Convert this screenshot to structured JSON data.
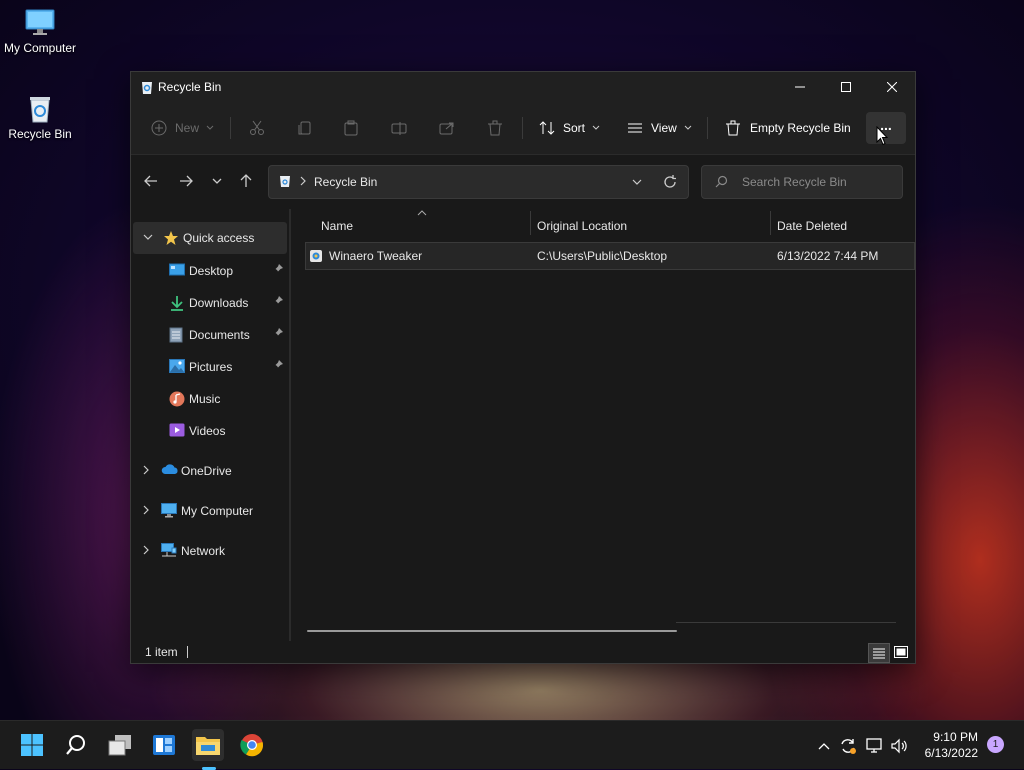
{
  "desktop": {
    "icons": [
      {
        "label": "My Computer",
        "icon": "monitor-icon"
      },
      {
        "label": "Recycle Bin",
        "icon": "recycle-bin-icon"
      }
    ]
  },
  "window": {
    "title": "Recycle Bin",
    "controls": {
      "minimize": "minimize-icon",
      "maximize": "maximize-icon",
      "close": "close-icon"
    }
  },
  "toolbar": {
    "new_label": "New",
    "sort_label": "Sort",
    "view_label": "View",
    "empty_label": "Empty Recycle Bin",
    "more_label": "..."
  },
  "navigation": {
    "breadcrumb": "Recycle Bin",
    "search_placeholder": "Search Recycle Bin"
  },
  "sidebar": {
    "quick_access": "Quick access",
    "pinned": [
      {
        "label": "Desktop",
        "icon": "desktop-icon",
        "pinned": true
      },
      {
        "label": "Downloads",
        "icon": "downloads-icon",
        "pinned": true
      },
      {
        "label": "Documents",
        "icon": "documents-icon",
        "pinned": true
      },
      {
        "label": "Pictures",
        "icon": "pictures-icon",
        "pinned": true
      },
      {
        "label": "Music",
        "icon": "music-icon",
        "pinned": false
      },
      {
        "label": "Videos",
        "icon": "videos-icon",
        "pinned": false
      }
    ],
    "onedrive": "OneDrive",
    "my_computer": "My Computer",
    "network": "Network"
  },
  "table": {
    "columns": [
      "Name",
      "Original Location",
      "Date Deleted"
    ],
    "rows": [
      {
        "name": "Winaero Tweaker",
        "location": "C:\\Users\\Public\\Desktop",
        "date": "6/13/2022 7:44 PM"
      }
    ]
  },
  "status": {
    "item_count": "1 item"
  },
  "taskbar": {
    "time": "9:10 PM",
    "date": "6/13/2022",
    "notification_count": "1"
  },
  "colors": {
    "window_bg": "#191919",
    "chrome_bg": "#202020",
    "accent": "#4cc2ff",
    "folder_yellow": "#f2c54b"
  }
}
